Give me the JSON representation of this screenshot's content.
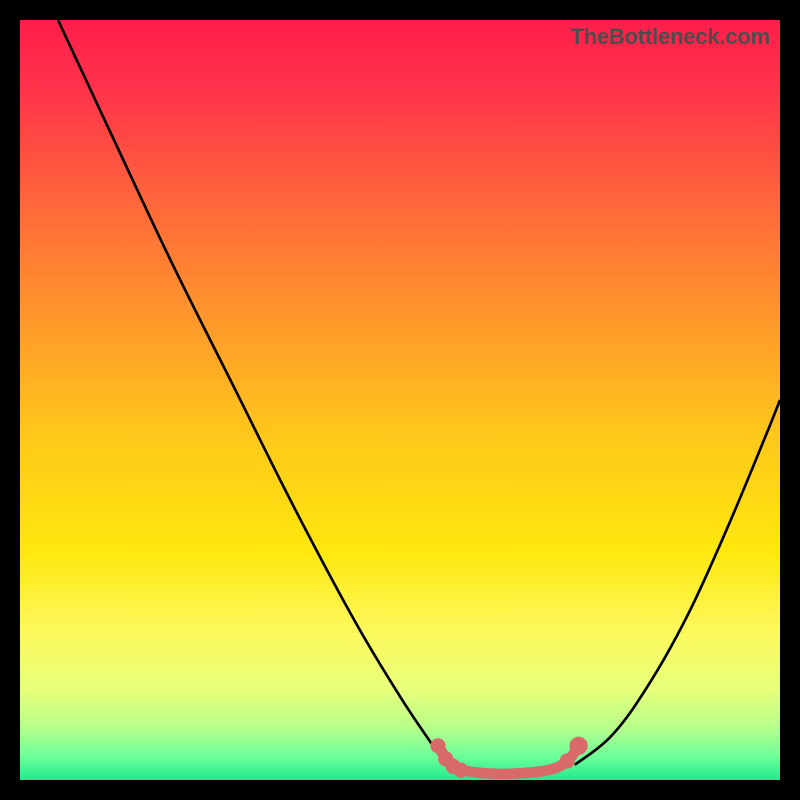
{
  "watermark": "TheBottleneck.com",
  "chart_data": {
    "type": "line",
    "title": "",
    "xlabel": "",
    "ylabel": "",
    "xlim": [
      0,
      100
    ],
    "ylim": [
      0,
      100
    ],
    "background_gradient_stops": [
      {
        "offset": 0.0,
        "color": "#ff1e4b"
      },
      {
        "offset": 0.1,
        "color": "#ff3549"
      },
      {
        "offset": 0.25,
        "color": "#ff6a3a"
      },
      {
        "offset": 0.4,
        "color": "#ff9a2a"
      },
      {
        "offset": 0.55,
        "color": "#ffc81a"
      },
      {
        "offset": 0.7,
        "color": "#ffe80e"
      },
      {
        "offset": 0.8,
        "color": "#fdf85a"
      },
      {
        "offset": 0.88,
        "color": "#e8ff7a"
      },
      {
        "offset": 0.93,
        "color": "#b8ff8a"
      },
      {
        "offset": 0.97,
        "color": "#6bff9a"
      },
      {
        "offset": 1.0,
        "color": "#22e98e"
      }
    ],
    "series": [
      {
        "name": "left-curve",
        "points": [
          {
            "x": 5,
            "y": 100
          },
          {
            "x": 12,
            "y": 85
          },
          {
            "x": 20,
            "y": 68
          },
          {
            "x": 28,
            "y": 52
          },
          {
            "x": 36,
            "y": 36
          },
          {
            "x": 44,
            "y": 21
          },
          {
            "x": 50,
            "y": 11
          },
          {
            "x": 54,
            "y": 5
          },
          {
            "x": 56,
            "y": 2
          }
        ]
      },
      {
        "name": "right-curve",
        "points": [
          {
            "x": 73,
            "y": 2
          },
          {
            "x": 78,
            "y": 6
          },
          {
            "x": 83,
            "y": 13
          },
          {
            "x": 88,
            "y": 22
          },
          {
            "x": 93,
            "y": 33
          },
          {
            "x": 98,
            "y": 45
          },
          {
            "x": 100,
            "y": 50
          }
        ]
      },
      {
        "name": "bottom-band",
        "color": "#d86a6a",
        "points": [
          {
            "x": 55,
            "y": 4.5
          },
          {
            "x": 56,
            "y": 3.0
          },
          {
            "x": 57,
            "y": 2.0
          },
          {
            "x": 58,
            "y": 1.4
          },
          {
            "x": 60,
            "y": 1.0
          },
          {
            "x": 63,
            "y": 0.8
          },
          {
            "x": 66,
            "y": 0.9
          },
          {
            "x": 69,
            "y": 1.2
          },
          {
            "x": 71,
            "y": 1.8
          },
          {
            "x": 72.5,
            "y": 3.0
          },
          {
            "x": 73.5,
            "y": 4.5
          }
        ]
      }
    ],
    "markers": [
      {
        "x": 55.0,
        "y": 4.5,
        "r": 1.0,
        "color": "#d86a6a"
      },
      {
        "x": 56.0,
        "y": 2.8,
        "r": 1.0,
        "color": "#d86a6a"
      },
      {
        "x": 57.0,
        "y": 1.8,
        "r": 1.0,
        "color": "#d86a6a"
      },
      {
        "x": 58.0,
        "y": 1.3,
        "r": 1.0,
        "color": "#d86a6a"
      },
      {
        "x": 72.0,
        "y": 2.5,
        "r": 1.0,
        "color": "#d86a6a"
      },
      {
        "x": 73.5,
        "y": 4.5,
        "r": 1.2,
        "color": "#d86a6a"
      }
    ]
  }
}
